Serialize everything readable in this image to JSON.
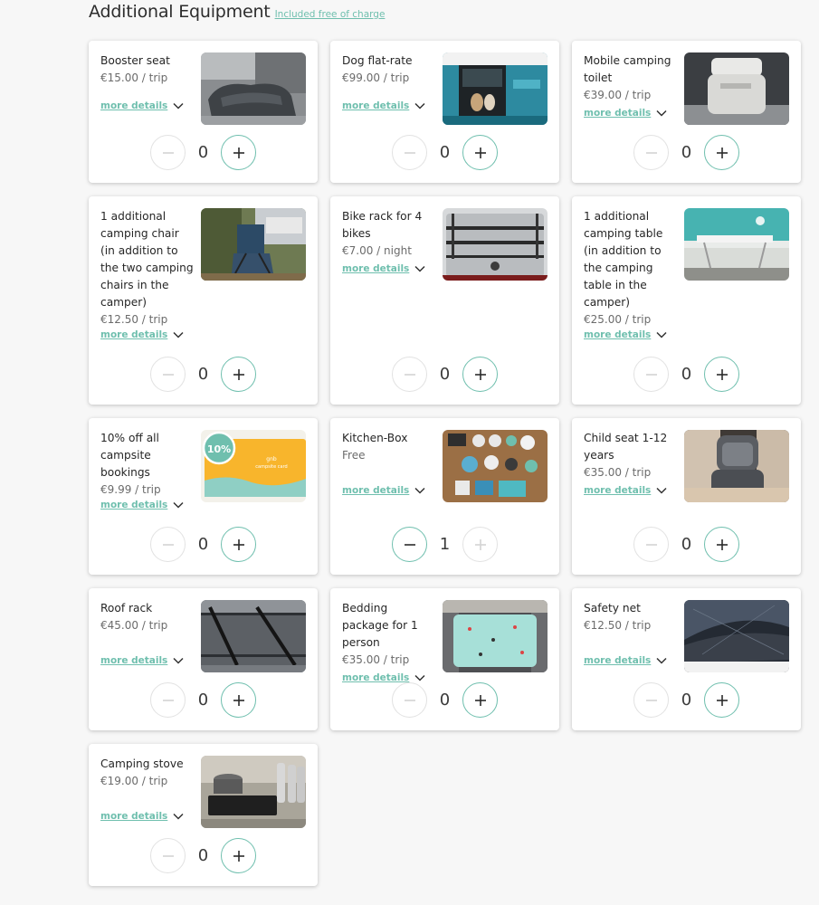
{
  "header": {
    "title": "Additional Equipment",
    "note": "Included free of charge"
  },
  "colors": {
    "accent": "#6fbfae",
    "disabled": "#d4d4d4"
  },
  "items": [
    {
      "name": "Booster seat",
      "price": "€15.00 / trip",
      "more": "more details",
      "count": "0",
      "minus_enabled": false,
      "plus_enabled": true,
      "image": "booster-seat-photo"
    },
    {
      "name": "Dog flat-rate",
      "price": "€99.00 / trip",
      "more": "more details",
      "count": "0",
      "minus_enabled": false,
      "plus_enabled": true,
      "image": "dog-in-van-photo"
    },
    {
      "name": "Mobile camping toilet",
      "price": "€39.00 / trip",
      "more": "more details",
      "count": "0",
      "minus_enabled": false,
      "plus_enabled": true,
      "image": "camping-toilet-photo"
    },
    {
      "name": "1 additional camping chair (in addition to the two camping chairs in the camper)",
      "price": "€12.50 / trip",
      "more": "more details",
      "count": "0",
      "minus_enabled": false,
      "plus_enabled": true,
      "image": "camping-chair-photo"
    },
    {
      "name": "Bike rack for 4 bikes",
      "price": "€7.00 / night",
      "more": "more details",
      "count": "0",
      "minus_enabled": false,
      "plus_enabled": true,
      "image": "bike-rack-photo"
    },
    {
      "name": "1 additional camping table (in addition to the camping table in the camper)",
      "price": "€25.00 / trip",
      "more": "more details",
      "count": "0",
      "minus_enabled": false,
      "plus_enabled": true,
      "image": "camping-table-photo"
    },
    {
      "name": "10% off all campsite bookings",
      "price": "€9.99 / trip",
      "more": "more details",
      "count": "0",
      "minus_enabled": false,
      "plus_enabled": true,
      "image": "campsite-card-graphic",
      "badge": "10%",
      "card_lines": [
        "gnb",
        "campsite card"
      ]
    },
    {
      "name": "Kitchen-Box",
      "price": "Free",
      "more": "more details",
      "count": "1",
      "minus_enabled": true,
      "plus_enabled": false,
      "image": "kitchen-box-photo"
    },
    {
      "name": "Child seat 1-12 years",
      "price": "€35.00 / trip",
      "more": "more details",
      "count": "0",
      "minus_enabled": false,
      "plus_enabled": true,
      "image": "child-seat-photo"
    },
    {
      "name": "Roof rack",
      "price": "€45.00 / trip",
      "more": "more details",
      "count": "0",
      "minus_enabled": false,
      "plus_enabled": true,
      "image": "roof-rack-photo"
    },
    {
      "name": "Bedding package for 1 person",
      "price": "€35.00 / trip",
      "more": "more details",
      "count": "0",
      "minus_enabled": false,
      "plus_enabled": true,
      "image": "bedding-photo"
    },
    {
      "name": "Safety net",
      "price": "€12.50 / trip",
      "more": "more details",
      "count": "0",
      "minus_enabled": false,
      "plus_enabled": true,
      "image": "safety-net-photo"
    },
    {
      "name": "Camping stove",
      "price": "€19.00 / trip",
      "more": "more details",
      "count": "0",
      "minus_enabled": false,
      "plus_enabled": true,
      "image": "camping-stove-photo"
    }
  ]
}
